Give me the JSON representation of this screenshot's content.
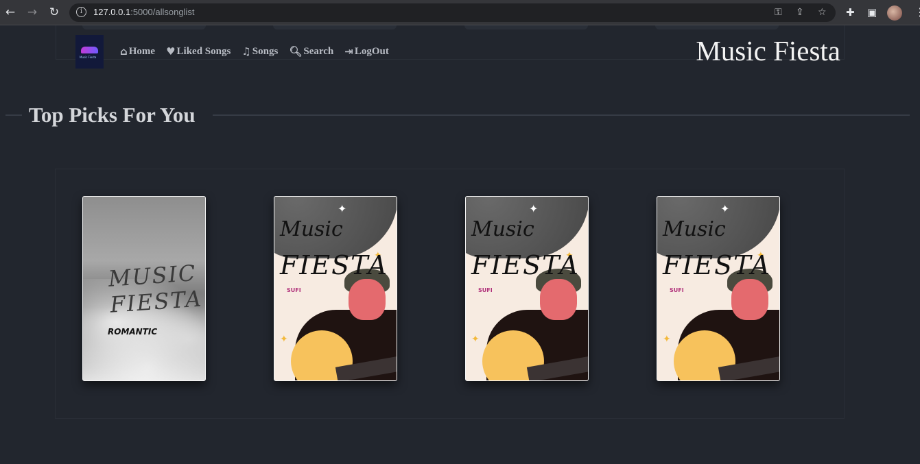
{
  "browser": {
    "url_host": "127.0.0.1",
    "url_path": ":5000/allsonglist",
    "back_icon": "arrow-left-icon",
    "forward_icon": "arrow-right-icon",
    "reload_icon": "reload-icon"
  },
  "navbar": {
    "brand": "Music Fiesta",
    "logo_text": "Music Fiesta",
    "links": [
      {
        "label": "Home",
        "icon": "home-icon"
      },
      {
        "label": "Liked Songs",
        "icon": "heart-icon"
      },
      {
        "label": "Songs",
        "icon": "music-note-icon"
      },
      {
        "label": "Search",
        "icon": "search-icon"
      },
      {
        "label": "LogOut",
        "icon": "logout-icon"
      }
    ]
  },
  "section": {
    "title": "Top Picks For You"
  },
  "cards": [
    {
      "cover": "romantic",
      "title_art": "MUSIC FIESTA",
      "genre": "ROMANTIC"
    },
    {
      "cover": "sufi",
      "title_art_1": "Music",
      "title_art_2": "FIESTA",
      "genre": "SUFI"
    },
    {
      "cover": "sufi",
      "title_art_1": "Music",
      "title_art_2": "FIESTA",
      "genre": "SUFI"
    },
    {
      "cover": "sufi",
      "title_art_1": "Music",
      "title_art_2": "FIESTA",
      "genre": "SUFI"
    }
  ]
}
